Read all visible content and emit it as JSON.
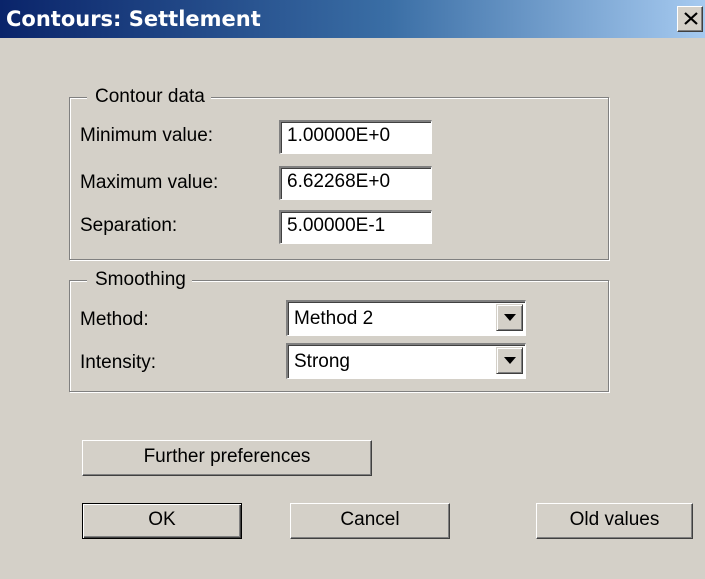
{
  "window": {
    "title": "Contours: Settlement",
    "close_icon": "close-icon"
  },
  "contour_data": {
    "legend": "Contour data",
    "minimum": {
      "label": "Minimum value:",
      "value": "1.00000E+0"
    },
    "maximum": {
      "label": "Maximum value:",
      "value": "6.62268E+0"
    },
    "separation": {
      "label": "Separation:",
      "value": "5.00000E-1"
    }
  },
  "smoothing": {
    "legend": "Smoothing",
    "method": {
      "label": "Method:",
      "value": "Method 2"
    },
    "intensity": {
      "label": "Intensity:",
      "value": "Strong"
    }
  },
  "buttons": {
    "further_preferences": "Further preferences",
    "ok": "OK",
    "cancel": "Cancel",
    "old_values": "Old values"
  },
  "colors": {
    "dialog_face": "#d4d0c8",
    "titlebar_start": "#0a246a",
    "titlebar_end": "#a6caf0",
    "title_text": "#ffffff"
  }
}
